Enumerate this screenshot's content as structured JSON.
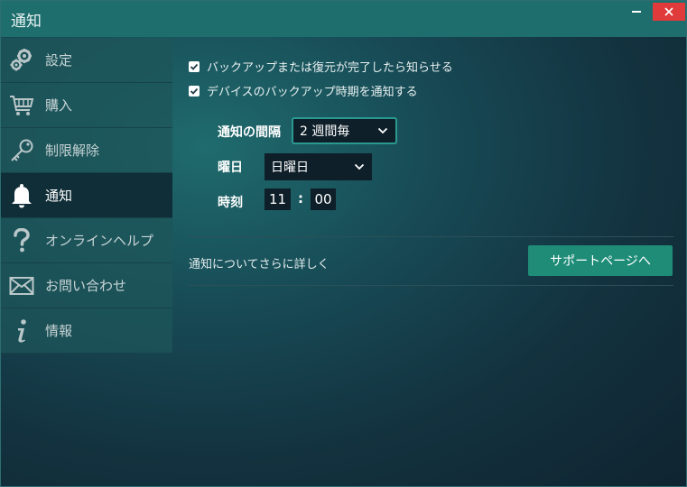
{
  "window": {
    "title": "通知",
    "minimize_icon": "minimize-icon",
    "close_icon": "close-icon",
    "close_color": "#e03a3a",
    "titlebar_color": "#1d6e6d"
  },
  "sidebar": {
    "items": [
      {
        "label": "設定",
        "icon": "gears-icon",
        "active": false
      },
      {
        "label": "購入",
        "icon": "cart-icon",
        "active": false
      },
      {
        "label": "制限解除",
        "icon": "key-icon",
        "active": false
      },
      {
        "label": "通知",
        "icon": "bell-icon",
        "active": true
      },
      {
        "label": "オンラインヘルプ",
        "icon": "question-icon",
        "active": false
      },
      {
        "label": "お問い合わせ",
        "icon": "envelope-icon",
        "active": false
      },
      {
        "label": "情報",
        "icon": "info-icon",
        "active": false
      }
    ]
  },
  "notifications": {
    "options": [
      {
        "label": "バックアップまたは復元が完了したら知らせる",
        "checked": true
      },
      {
        "label": "デバイスのバックアップ時期を通知する",
        "checked": true
      }
    ],
    "interval": {
      "label": "通知の間隔",
      "value": "2 週間毎"
    },
    "weekday": {
      "label": "曜日",
      "value": "日曜日"
    },
    "time": {
      "label": "時刻",
      "hour": "11",
      "separator": ":",
      "minute": "00"
    }
  },
  "support": {
    "text": "通知についてさらに詳しく",
    "button_label": "サポートページへ",
    "button_color": "#1f8c78"
  }
}
